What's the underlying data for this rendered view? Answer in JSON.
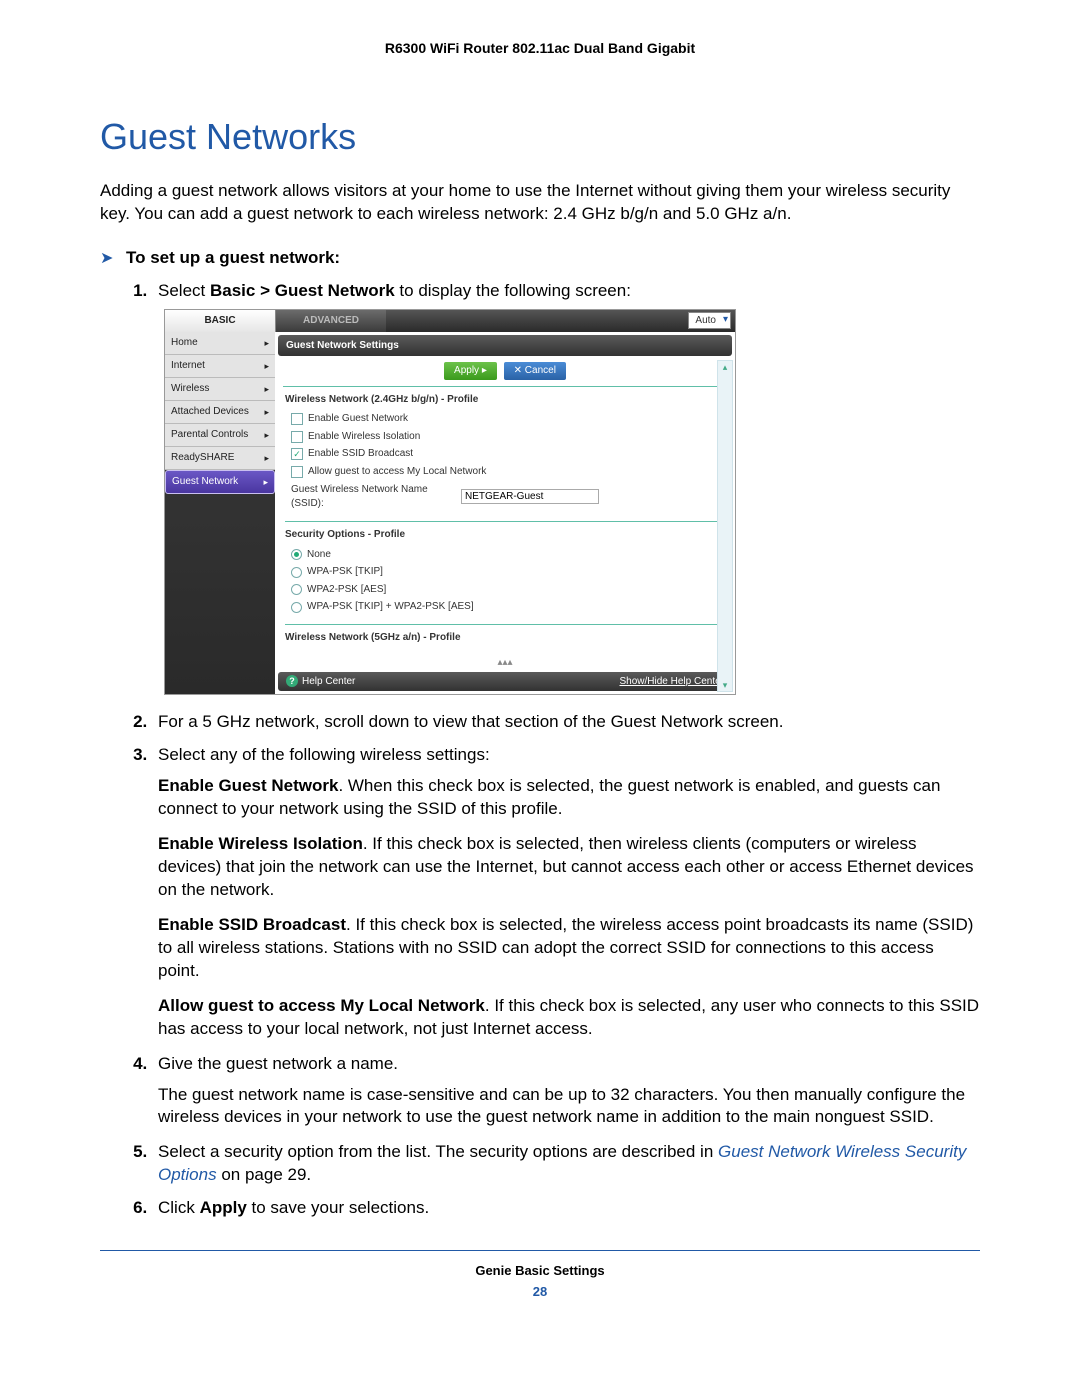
{
  "doc": {
    "header": "R6300 WiFi Router 802.11ac Dual Band Gigabit",
    "footer_title": "Genie Basic Settings",
    "page_number": "28"
  },
  "section": {
    "title": "Guest Networks",
    "intro": "Adding a guest network allows visitors at your home to use the Internet without giving them your wireless security key. You can add a guest network to each wireless network: 2.4 GHz b/g/n and 5.0 GHz a/n.",
    "task_heading": "To set up a guest network:"
  },
  "steps": {
    "s1_a": "Select ",
    "s1_b": "Basic > Guest Network",
    "s1_c": " to display the following screen:",
    "s2": "For a 5 GHz network, scroll down to view that section of the Guest Network screen.",
    "s3": "Select any of the following wireless settings:",
    "enable_guest_label": "Enable Guest Network",
    "enable_guest_text": ". When this check box is selected, the guest network is enabled, and guests can connect to your network using the SSID of this profile.",
    "enable_iso_label": "Enable Wireless Isolation",
    "enable_iso_text": ". If this check box is selected, then wireless clients (computers or wireless devices) that join the network can use the Internet, but cannot access each other or access Ethernet devices on the network.",
    "enable_ssid_label": "Enable SSID Broadcast",
    "enable_ssid_text": ". If this check box is selected, the wireless access point broadcasts its name (SSID) to all wireless stations. Stations with no SSID can adopt the correct SSID for connections to this access point.",
    "allow_local_label": "Allow guest to access My Local Network",
    "allow_local_text": ". If this check box is selected, any user who connects to this SSID has access to your local network, not just Internet access.",
    "s4": "Give the guest network a name.",
    "s4_body": "The guest network name is case-sensitive and can be up to 32 characters. You then manually configure the wireless devices in your network to use the guest network name in addition to the main nonguest SSID.",
    "s5_a": "Select a security option from the list. The security options are described in ",
    "s5_link": "Guest Network Wireless Security Options",
    "s5_b": " on page 29.",
    "s6_a": "Click ",
    "s6_b": "Apply",
    "s6_c": " to save your selections."
  },
  "genie": {
    "tabs": {
      "basic": "BASIC",
      "advanced": "ADVANCED"
    },
    "language": "Auto",
    "sidebar": [
      {
        "label": "Home"
      },
      {
        "label": "Internet"
      },
      {
        "label": "Wireless"
      },
      {
        "label": "Attached Devices"
      },
      {
        "label": "Parental Controls"
      },
      {
        "label": "ReadySHARE"
      },
      {
        "label": "Guest Network",
        "active": true
      }
    ],
    "pane_title": "Guest Network Settings",
    "buttons": {
      "apply": "Apply ▸",
      "cancel": "✕ Cancel"
    },
    "profile24": {
      "title": "Wireless Network (2.4GHz b/g/n) - Profile",
      "cb_guest": "Enable Guest Network",
      "cb_iso": "Enable Wireless Isolation",
      "cb_ssid": "Enable SSID Broadcast",
      "cb_local": "Allow guest to access My Local Network",
      "ssid_label": "Guest Wireless Network Name (SSID):",
      "ssid_value": "NETGEAR-Guest"
    },
    "security": {
      "title": "Security Options - Profile",
      "none": "None",
      "wpa": "WPA-PSK [TKIP]",
      "wpa2": "WPA2-PSK [AES]",
      "both": "WPA-PSK [TKIP] + WPA2-PSK [AES]"
    },
    "profile5": {
      "title": "Wireless Network (5GHz a/n) - Profile"
    },
    "help": {
      "label": "Help Center",
      "show": "Show/Hide Help Center"
    }
  }
}
